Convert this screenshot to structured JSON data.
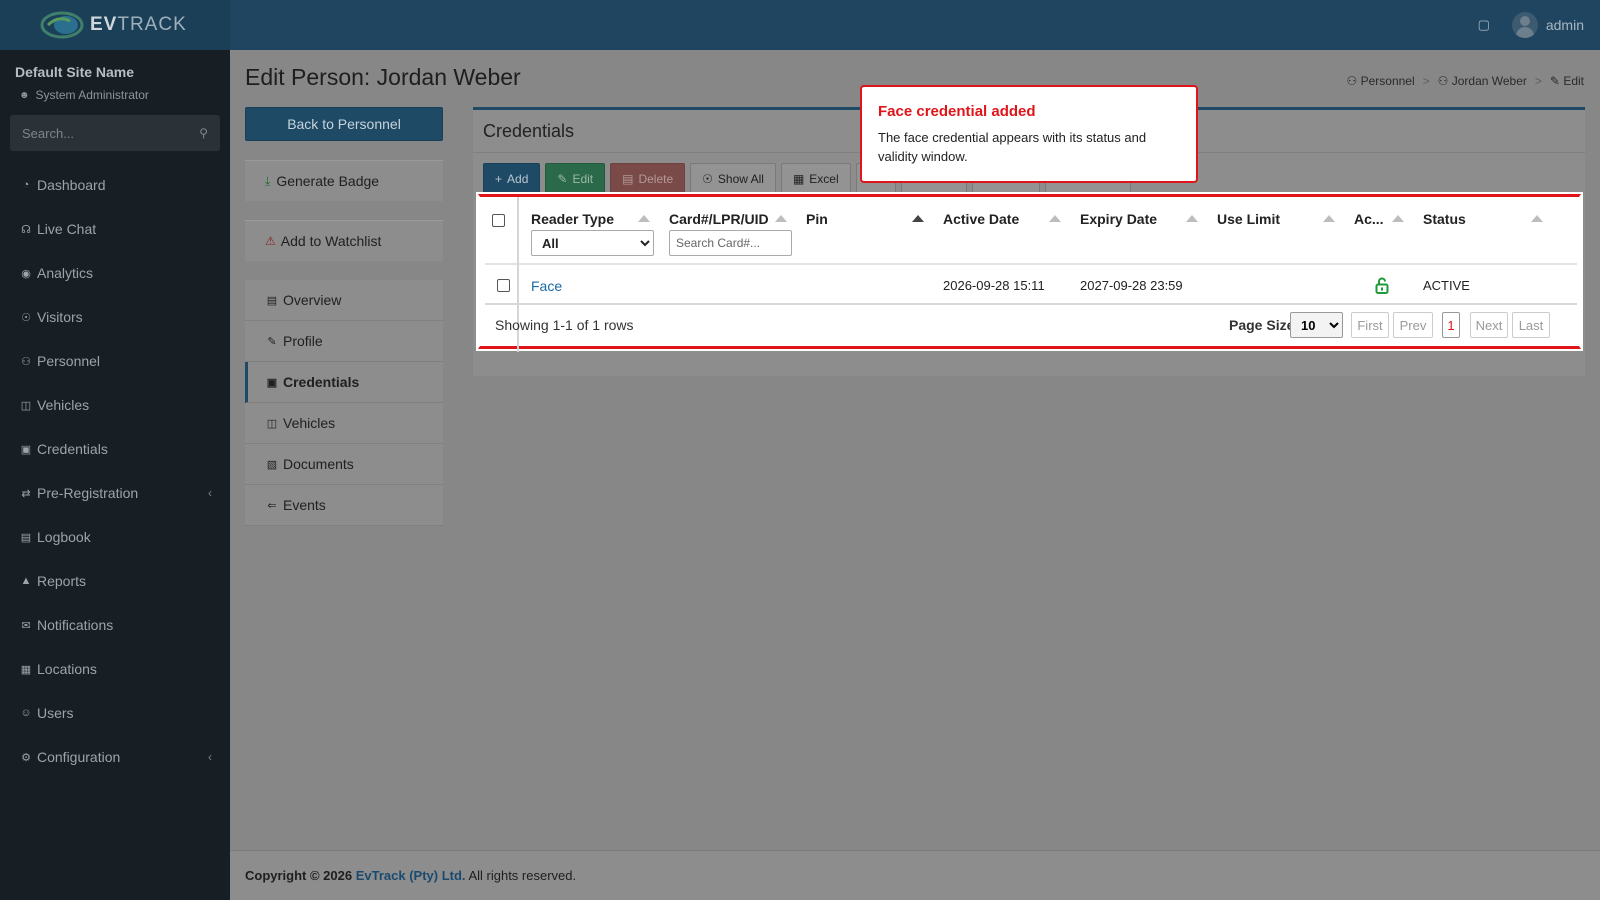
{
  "app": {
    "logo_text_strong": "EV",
    "logo_text": "TRACK",
    "user_name": "admin"
  },
  "sidebar": {
    "site_name": "Default Site Name",
    "role": "System Administrator",
    "search_placeholder": "Search...",
    "items": [
      {
        "label": "Dashboard",
        "icon": "dashboard-icon"
      },
      {
        "label": "Live Chat",
        "icon": "headset-icon"
      },
      {
        "label": "Analytics",
        "icon": "analytics-icon"
      },
      {
        "label": "Visitors",
        "icon": "eye-icon"
      },
      {
        "label": "Personnel",
        "icon": "user-group-icon"
      },
      {
        "label": "Vehicles",
        "icon": "car-icon"
      },
      {
        "label": "Credentials",
        "icon": "id-card-icon"
      },
      {
        "label": "Pre-Registration",
        "icon": "swap-icon"
      },
      {
        "label": "Logbook",
        "icon": "book-icon"
      },
      {
        "label": "Reports",
        "icon": "chart-icon"
      },
      {
        "label": "Notifications",
        "icon": "message-icon"
      },
      {
        "label": "Locations",
        "icon": "building-icon"
      },
      {
        "label": "Users",
        "icon": "users-icon"
      },
      {
        "label": "Configuration",
        "icon": "gear-icon"
      }
    ]
  },
  "page": {
    "title": "Edit Person: Jordan Weber",
    "breadcrumb": [
      "Personnel",
      "Jordan Weber",
      "Edit"
    ]
  },
  "left_panel": {
    "back_label": "Back to Personnel",
    "generate_badge": "Generate Badge",
    "add_watchlist": "Add to Watchlist",
    "tabs": [
      "Overview",
      "Profile",
      "Credentials",
      "Vehicles",
      "Documents",
      "Events"
    ]
  },
  "credentials": {
    "title": "Credentials",
    "toolbar": {
      "add": "Add",
      "edit": "Edit",
      "delete": "Delete",
      "show_all": "Show All",
      "excel": "Excel"
    },
    "columns": [
      "Reader Type",
      "Card#/LPR/UID",
      "Pin",
      "Active Date",
      "Expiry Date",
      "Use Limit",
      "Ac...",
      "Status"
    ],
    "filter_reader_type": "All",
    "filter_card_placeholder": "Search Card#...",
    "rows": [
      {
        "reader_type": "Face",
        "card": "",
        "pin": "",
        "active_date": "2026-09-28 15:11",
        "expiry_date": "2027-09-28 23:59",
        "use_limit": "",
        "access_icon": "unlock-icon",
        "status": "ACTIVE"
      }
    ],
    "rows_info": "Showing 1-1 of 1 rows",
    "page_size_label": "Page Size",
    "page_size": "10",
    "pager": {
      "first": "First",
      "prev": "Prev",
      "current": "1",
      "next": "Next",
      "last": "Last"
    }
  },
  "callout": {
    "title": "Face credential added",
    "body": "The face credential appears with its status and validity window."
  },
  "footer": {
    "prefix": "Copyright © 2026",
    "company": "EvTrack (Pty) Ltd.",
    "suffix": "All rights reserved."
  },
  "colors": {
    "highlight": "#e0151b",
    "primary": "#1e4a66",
    "success": "#2a6a4a",
    "danger": "#7a4a48",
    "unlock": "#1f9a3a"
  }
}
